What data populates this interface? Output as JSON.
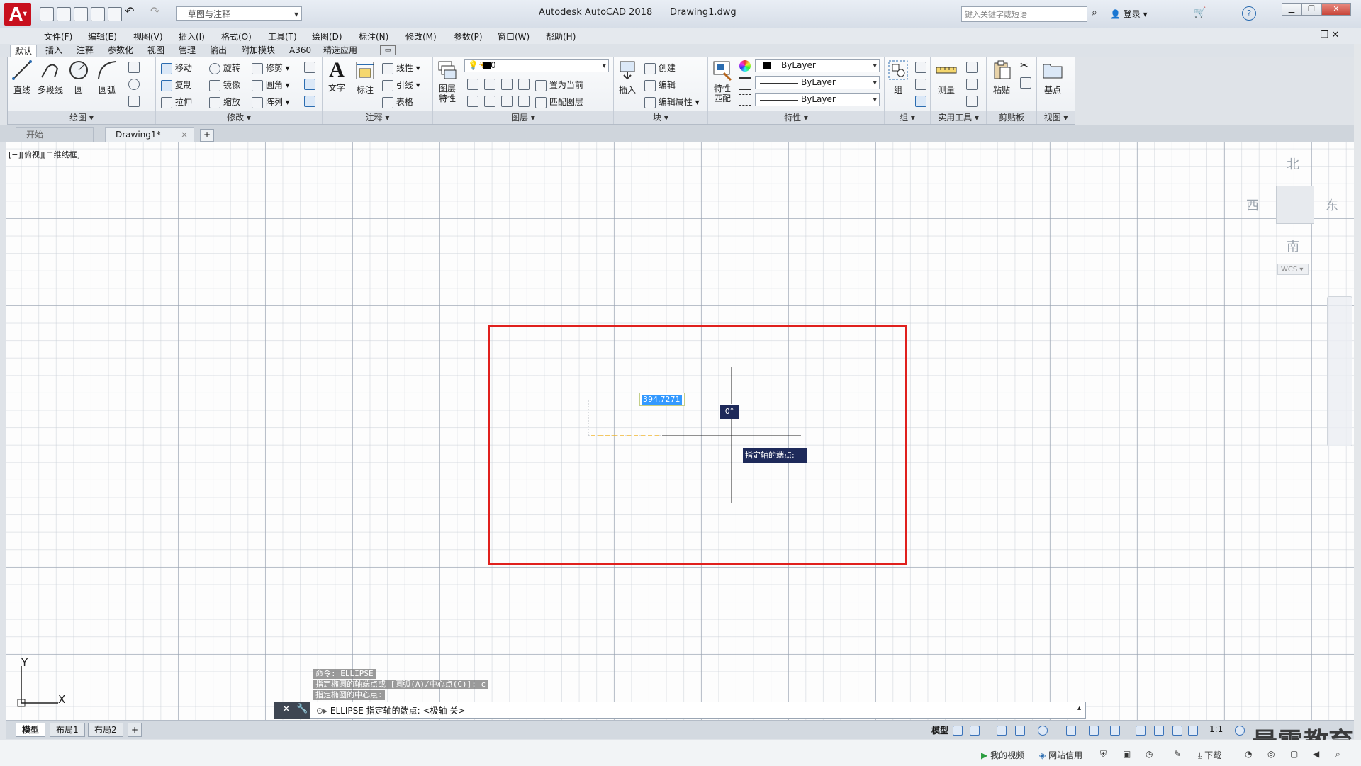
{
  "titlebar": {
    "app_title": "Autodesk AutoCAD 2018",
    "file_name": "Drawing1.dwg",
    "workspace": "草图与注释",
    "search_placeholder": "键入关键字或短语",
    "login": "登录",
    "logo_letter": "A"
  },
  "menu": [
    "文件(F)",
    "编辑(E)",
    "视图(V)",
    "插入(I)",
    "格式(O)",
    "工具(T)",
    "绘图(D)",
    "标注(N)",
    "修改(M)",
    "参数(P)",
    "窗口(W)",
    "帮助(H)"
  ],
  "ribbon_tabs": [
    "默认",
    "插入",
    "注释",
    "参数化",
    "视图",
    "管理",
    "输出",
    "附加模块",
    "A360",
    "精选应用"
  ],
  "ribbon": {
    "draw": {
      "title": "绘图",
      "line": "直线",
      "polyline": "多段线",
      "circle": "圆",
      "arc": "圆弧"
    },
    "modify": {
      "title": "修改",
      "move": "移动",
      "rotate": "旋转",
      "trim": "修剪",
      "copy": "复制",
      "mirror": "镜像",
      "fillet": "圆角",
      "stretch": "拉伸",
      "scale": "缩放",
      "array": "阵列"
    },
    "annotation": {
      "title": "注释",
      "text": "文字",
      "dimension": "标注",
      "linear": "线性",
      "leader": "引线",
      "table": "表格"
    },
    "layers": {
      "title": "图层",
      "properties_line1": "图层",
      "properties_line2": "特性",
      "current_layer": "0",
      "set_current": "置为当前",
      "match_layer": "匹配图层"
    },
    "block": {
      "title": "块",
      "insert": "插入",
      "create": "创建",
      "edit": "编辑",
      "edit_attr": "编辑属性"
    },
    "properties": {
      "title": "特性",
      "match_line1": "特性",
      "match_line2": "匹配",
      "color": "ByLayer",
      "linetype": "ByLayer",
      "lineweight": "ByLayer"
    },
    "groups": {
      "title": "组",
      "group": "组"
    },
    "utilities": {
      "title": "实用工具",
      "measure": "测量"
    },
    "clipboard": {
      "title": "剪贴板",
      "paste": "粘贴"
    },
    "view": {
      "title": "视图",
      "base": "基点"
    }
  },
  "file_tabs": {
    "start": "开始",
    "drawing": "Drawing1*",
    "close": "×",
    "add": "+"
  },
  "viewport": {
    "label": "[−][俯视][二维线框]",
    "viewcube": {
      "north": "北",
      "south": "南",
      "east": "东",
      "west": "西"
    },
    "wcs": "WCS",
    "dim_value": "394.7271",
    "angle": "0°",
    "prompt": "指定轴的端点:"
  },
  "ucs": {
    "y": "Y",
    "x": "X"
  },
  "command": {
    "history": [
      "命令: ELLIPSE",
      "指定椭圆的轴端点或 [圆弧(A)/中心点(C)]: c",
      "指定椭圆的中心点:"
    ],
    "current": "ELLIPSE 指定轴的端点:  <极轴 关>"
  },
  "layout_tabs": [
    "模型",
    "布局1",
    "布局2"
  ],
  "status": {
    "model": "模型",
    "scale": "1:1"
  },
  "watermark": "最需教育",
  "taskbar": {
    "video": "我的视频",
    "credit": "网站信用",
    "download": "下载"
  },
  "colors": {
    "accent": "#c8101e",
    "rectangle": "#e0201d",
    "tooltip": "#1e2a5a",
    "selection": "#3399ff"
  }
}
